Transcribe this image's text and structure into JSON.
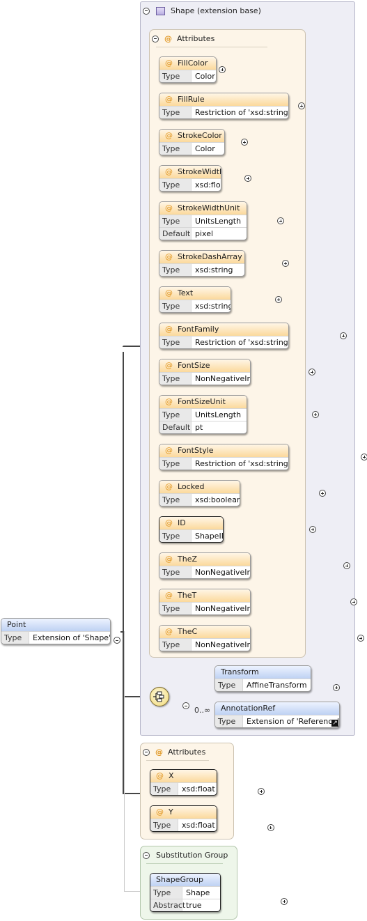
{
  "base_group": {
    "title": "Shape (extension base)"
  },
  "inner_attributes": {
    "title": "Attributes",
    "items": [
      {
        "name": "FillColor",
        "type": "Color"
      },
      {
        "name": "FillRule",
        "type": "Restriction of 'xsd:string'"
      },
      {
        "name": "StrokeColor",
        "type": "Color"
      },
      {
        "name": "StrokeWidth",
        "type": "xsd:float"
      },
      {
        "name": "StrokeWidthUnit",
        "type": "UnitsLength",
        "default": "pixel"
      },
      {
        "name": "StrokeDashArray",
        "type": "xsd:string"
      },
      {
        "name": "Text",
        "type": "xsd:string"
      },
      {
        "name": "FontFamily",
        "type": "Restriction of 'xsd:string'"
      },
      {
        "name": "FontSize",
        "type": "NonNegativeInt"
      },
      {
        "name": "FontSizeUnit",
        "type": "UnitsLength",
        "default": "pt"
      },
      {
        "name": "FontStyle",
        "type": "Restriction of 'xsd:string'"
      },
      {
        "name": "Locked",
        "type": "xsd:boolean"
      },
      {
        "name": "ID",
        "type": "ShapeID"
      },
      {
        "name": "TheZ",
        "type": "NonNegativeInt"
      },
      {
        "name": "TheT",
        "type": "NonNegativeInt"
      },
      {
        "name": "TheC",
        "type": "NonNegativeInt"
      }
    ]
  },
  "labels": {
    "type": "Type",
    "default": "Default",
    "abstract": "Abstract",
    "at": "@"
  },
  "root": {
    "name": "Point",
    "type": "Extension of 'Shape'"
  },
  "sequence": {
    "transform": {
      "name": "Transform",
      "type": "AffineTransform"
    },
    "annotation_ref": {
      "name": "AnnotationRef",
      "type": "Extension of 'Reference'",
      "cardinality": "0..∞"
    }
  },
  "point_attributes": {
    "title": "Attributes",
    "items": [
      {
        "name": "X",
        "type": "xsd:float"
      },
      {
        "name": "Y",
        "type": "xsd:float"
      }
    ]
  },
  "substitution_group": {
    "title": "Substitution Group",
    "item": {
      "name": "ShapeGroup",
      "type": "Shape",
      "abstract": "true"
    }
  },
  "colors": {
    "attribute_header": "#fbd99c",
    "element_header": "#bed1f3",
    "attribute_group_bg": "#fdf5e8",
    "base_group_bg": "#eeeef5",
    "substitution_bg": "#eef6ea",
    "at_sign": "#e0951e"
  }
}
